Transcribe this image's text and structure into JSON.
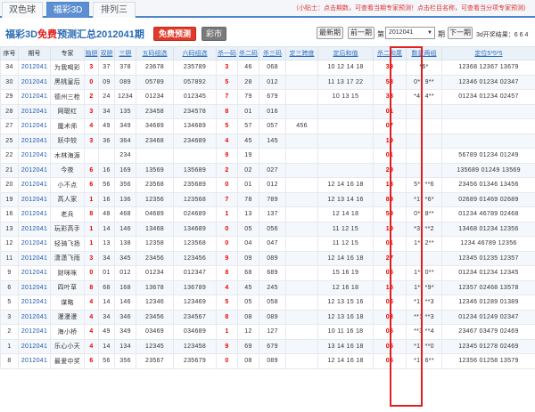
{
  "tabs": [
    "双色球",
    "福彩3D",
    "排列三"
  ],
  "tip": "（小贴士：点击期数，可查看当期专家预测！点击栏目名称，可查看当分项专家预测）",
  "title": {
    "pre": "福彩3D",
    "free": "免费",
    "post": "预测汇总2012041期"
  },
  "buttons": {
    "free_predict": "免费预测",
    "lottery": "彩市",
    "latest": "最新期",
    "prev": "前一期",
    "next": "下一期"
  },
  "issue_label": "第",
  "issue_value": "2012041",
  "issue_suffix": "期",
  "result_label": "3d开奖结果：6 6 4",
  "columns": [
    "序号",
    "期号",
    "专家",
    "独胆",
    "双胆",
    "三胆",
    "五码组选",
    "六码组选",
    "杀一码",
    "杀二码",
    "杀三码",
    "定三跨度",
    "定后和值",
    "杀二和尾",
    "数星两组",
    "定位5*5*5"
  ],
  "rows": [
    [
      "34",
      "2012041",
      "为我喝彩",
      "3",
      "37",
      "378",
      "23678",
      "235789",
      "3",
      "46",
      "068",
      "",
      "10 12 14 18",
      "39",
      "*6*",
      "12368 12367 13679"
    ],
    [
      "30",
      "2012041",
      "黑桃皇后",
      "0",
      "09",
      "089",
      "05789",
      "057892",
      "5",
      "28",
      "012",
      "",
      "11 13 17 22",
      "58",
      "0** 9**",
      "12346 01234 02347"
    ],
    [
      "29",
      "2012041",
      "德州三枪",
      "2",
      "24",
      "1234",
      "01234",
      "012345",
      "7",
      "79",
      "679",
      "",
      "10 13 15",
      "38",
      "*4* 4**",
      "01234 01234 02457"
    ],
    [
      "28",
      "2012041",
      "网聪红",
      "3",
      "34",
      "135",
      "23458",
      "234578",
      "8",
      "01",
      "016",
      "",
      "",
      "01",
      "",
      ""
    ],
    [
      "27",
      "2012041",
      "魔术师",
      "4",
      "49",
      "349",
      "34689",
      "134689",
      "5",
      "57",
      "057",
      "456",
      "",
      "07",
      "",
      ""
    ],
    [
      "25",
      "2012041",
      "跃中较",
      "3",
      "36",
      "364",
      "23468",
      "234689",
      "4",
      "45",
      "145",
      "",
      "",
      "19",
      "",
      ""
    ],
    [
      "22",
      "2012041",
      "木林海源",
      "",
      "",
      "234",
      "",
      "",
      "9",
      "19",
      "",
      "",
      "",
      "01",
      "",
      "56789 01234 01249"
    ],
    [
      "21",
      "2012041",
      "今夜",
      "6",
      "16",
      "169",
      "13569",
      "135689",
      "2",
      "02",
      "027",
      "",
      "",
      "29",
      "",
      "135689 01249 13569"
    ],
    [
      "20",
      "2012041",
      "小不点",
      "6",
      "56",
      "356",
      "23568",
      "235689",
      "0",
      "01",
      "012",
      "",
      "12 14 16 18",
      "13",
      "5** **6",
      "23456 01346 13456"
    ],
    [
      "19",
      "2012041",
      "高人家",
      "1",
      "16",
      "136",
      "12356",
      "123568",
      "7",
      "78",
      "789",
      "",
      "12 13 14 16",
      "89",
      "*1* *6*",
      "02689 01469 02689"
    ],
    [
      "16",
      "2012041",
      "老兵",
      "8",
      "48",
      "468",
      "04689",
      "024689",
      "1",
      "13",
      "137",
      "",
      "12 14 18",
      "59",
      "0** 8**",
      "01234 46789 02468"
    ],
    [
      "13",
      "2012041",
      "玩彩高手",
      "1",
      "14",
      "146",
      "13468",
      "134689",
      "0",
      "05",
      "056",
      "",
      "11 12 15",
      "19",
      "*3* **2",
      "13468 01234 12356"
    ],
    [
      "12",
      "2012041",
      "轻骑飞扬",
      "1",
      "13",
      "138",
      "12358",
      "123568",
      "0",
      "04",
      "047",
      "",
      "11 12 15",
      "01",
      "1** 2**",
      "1234 46789 12356"
    ],
    [
      "11",
      "2012041",
      "潇潇飞雨",
      "3",
      "34",
      "345",
      "23456",
      "123456",
      "9",
      "09",
      "089",
      "",
      "12 14 16 18",
      "27",
      "",
      "12345 01235 12357"
    ],
    [
      "9",
      "2012041",
      "财咪咪",
      "0",
      "01",
      "012",
      "01234",
      "012347",
      "8",
      "68",
      "689",
      "",
      "15 16 19",
      "05",
      "1** 0**",
      "01234 01234 12345"
    ],
    [
      "6",
      "2012041",
      "四叶草",
      "8",
      "68",
      "168",
      "13678",
      "136789",
      "4",
      "45",
      "245",
      "",
      "12 16 18",
      "15",
      "1** *9*",
      "12357 02468 13578"
    ],
    [
      "5",
      "2012041",
      "谋略",
      "4",
      "14",
      "146",
      "12346",
      "123469",
      "5",
      "05",
      "058",
      "",
      "12 13 15 16",
      "05",
      "*1* **3",
      "12346 01289 01389"
    ],
    [
      "3",
      "2012041",
      "漫漫漫",
      "4",
      "34",
      "346",
      "23456",
      "234567",
      "8",
      "08",
      "089",
      "",
      "12 13 16 18",
      "03",
      "**1 **3",
      "01234 01249 02347"
    ],
    [
      "2",
      "2012041",
      "海小桥",
      "4",
      "49",
      "349",
      "03469",
      "034689",
      "1",
      "12",
      "127",
      "",
      "10 11 16 18",
      "05",
      "**3 **4",
      "23467 03479 02469"
    ],
    [
      "1",
      "2012041",
      "乐心小天",
      "4",
      "14",
      "134",
      "12345",
      "123458",
      "9",
      "69",
      "679",
      "",
      "13 14 16 18",
      "05",
      "*1* **0",
      "12345 01278 02469"
    ],
    [
      "8",
      "2012041",
      "最爱中奖",
      "6",
      "56",
      "356",
      "23567",
      "235679",
      "0",
      "08",
      "089",
      "",
      "12 14 16 18",
      "05",
      "*1* 6**",
      "12356 01258 13579"
    ]
  ]
}
